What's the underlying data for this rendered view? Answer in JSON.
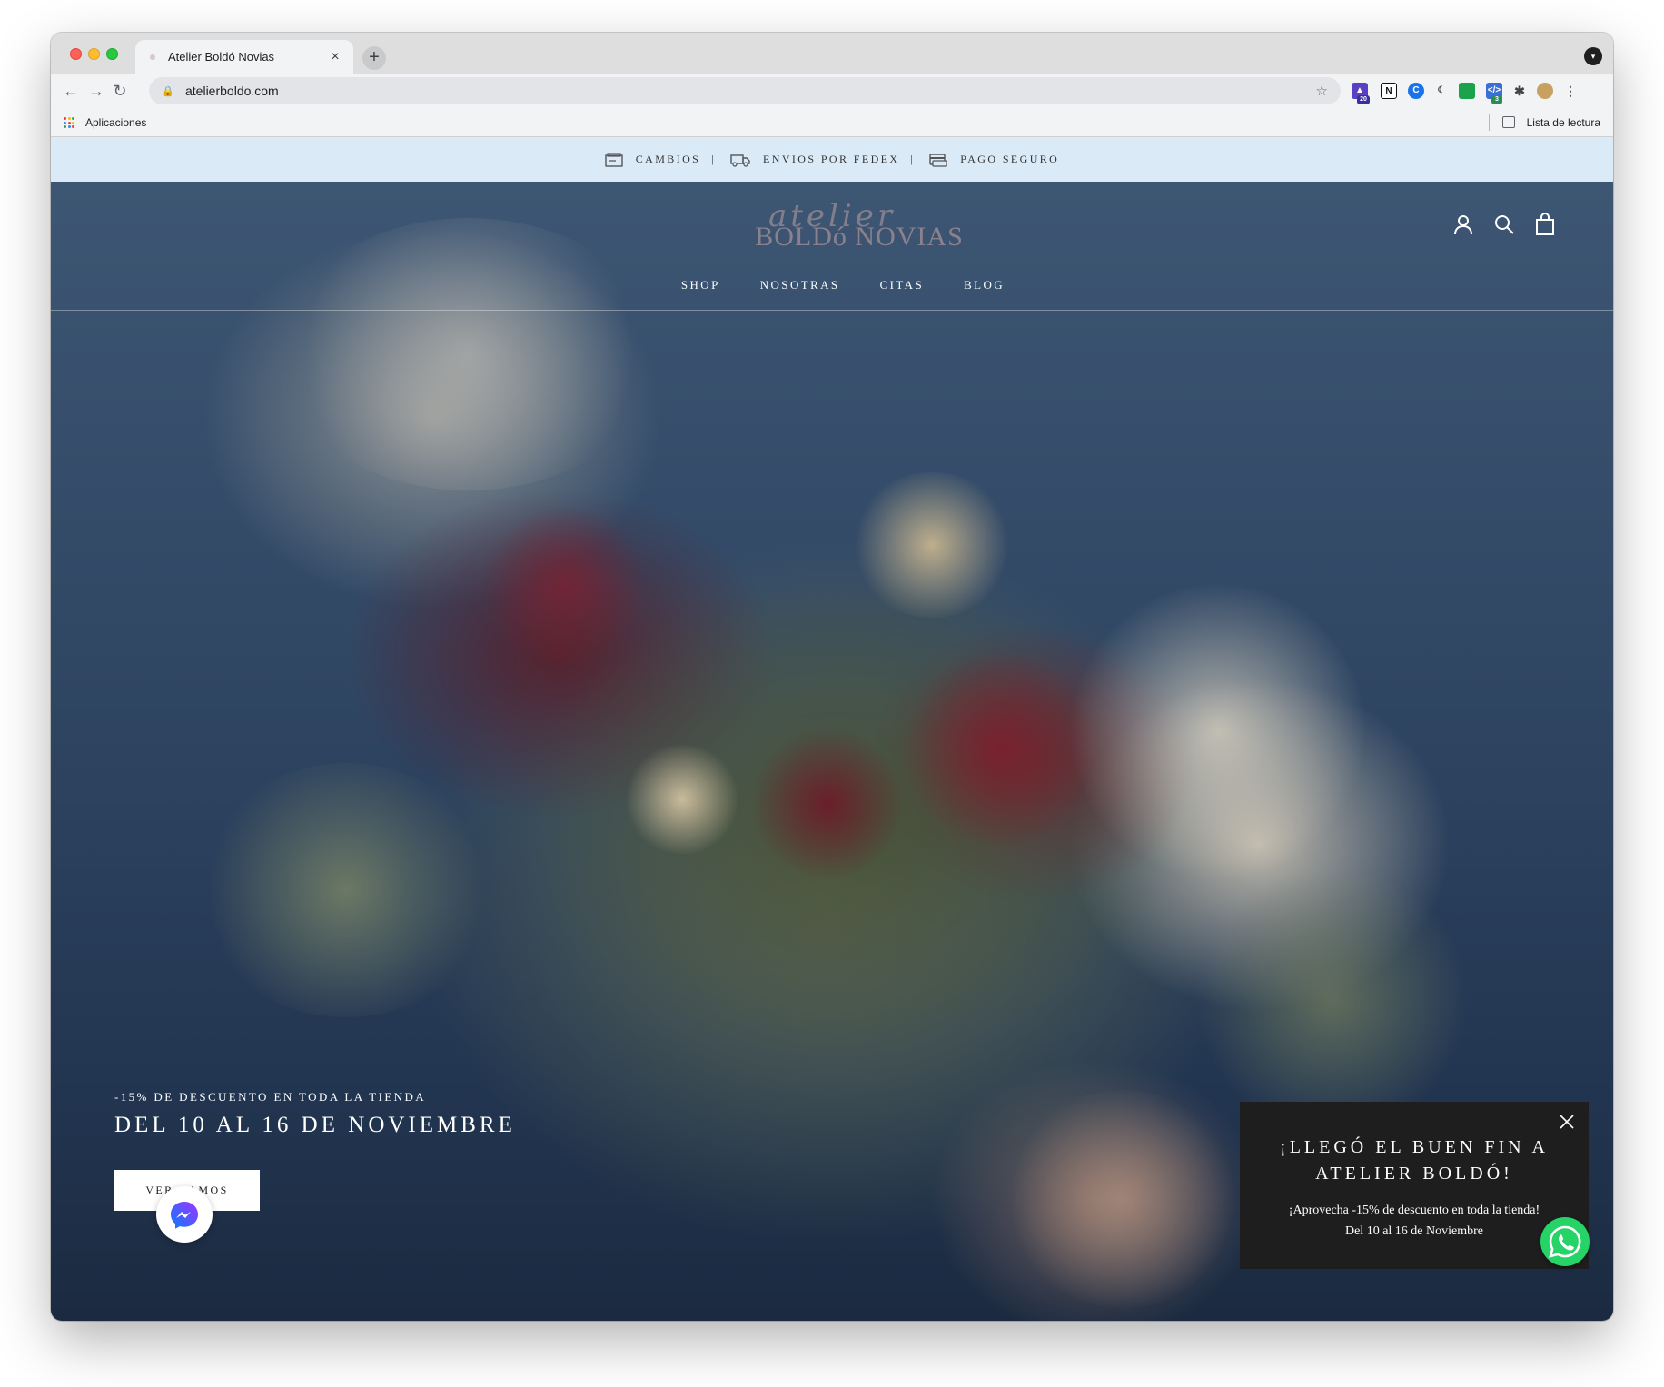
{
  "browser": {
    "tab_title": "Atelier Boldó Novias",
    "tab_close": "×",
    "new_tab": "+",
    "url": "atelierboldo.com",
    "bookmarks_apps": "Aplicaciones",
    "reading_list": "Lista de lectura",
    "extension_badges": [
      "20",
      "3"
    ]
  },
  "announcement": {
    "items": [
      "CAMBIOS",
      "ENVIOS POR FEDEX",
      "PAGO SEGURO"
    ],
    "separator": "|"
  },
  "site": {
    "logo_script": "atelier",
    "logo_main": "BOLDó NOVIAS",
    "nav": [
      "SHOP",
      "NOSOTRAS",
      "CITAS",
      "BLOG"
    ],
    "icons": [
      "account-icon",
      "search-icon",
      "shopping-bag-icon"
    ]
  },
  "hero": {
    "promo_subtitle": "-15% DE DESCUENTO EN TODA LA TIENDA",
    "promo_title": "DEL 10 AL 16 DE NOVIEMBRE",
    "cta_label": "VER RAMOS"
  },
  "popup": {
    "title": "¡LLEGÓ EL BUEN FIN A ATELIER BOLDÓ!",
    "line1": "¡Aprovecha -15% de descuento en toda la tienda!",
    "line2": "Del 10 al 16 de Noviembre"
  },
  "colors": {
    "announcement_bg": "#dbeaf7",
    "popup_bg": "#1e1e1e",
    "whatsapp": "#25d366",
    "messenger": "#0a7cff"
  }
}
